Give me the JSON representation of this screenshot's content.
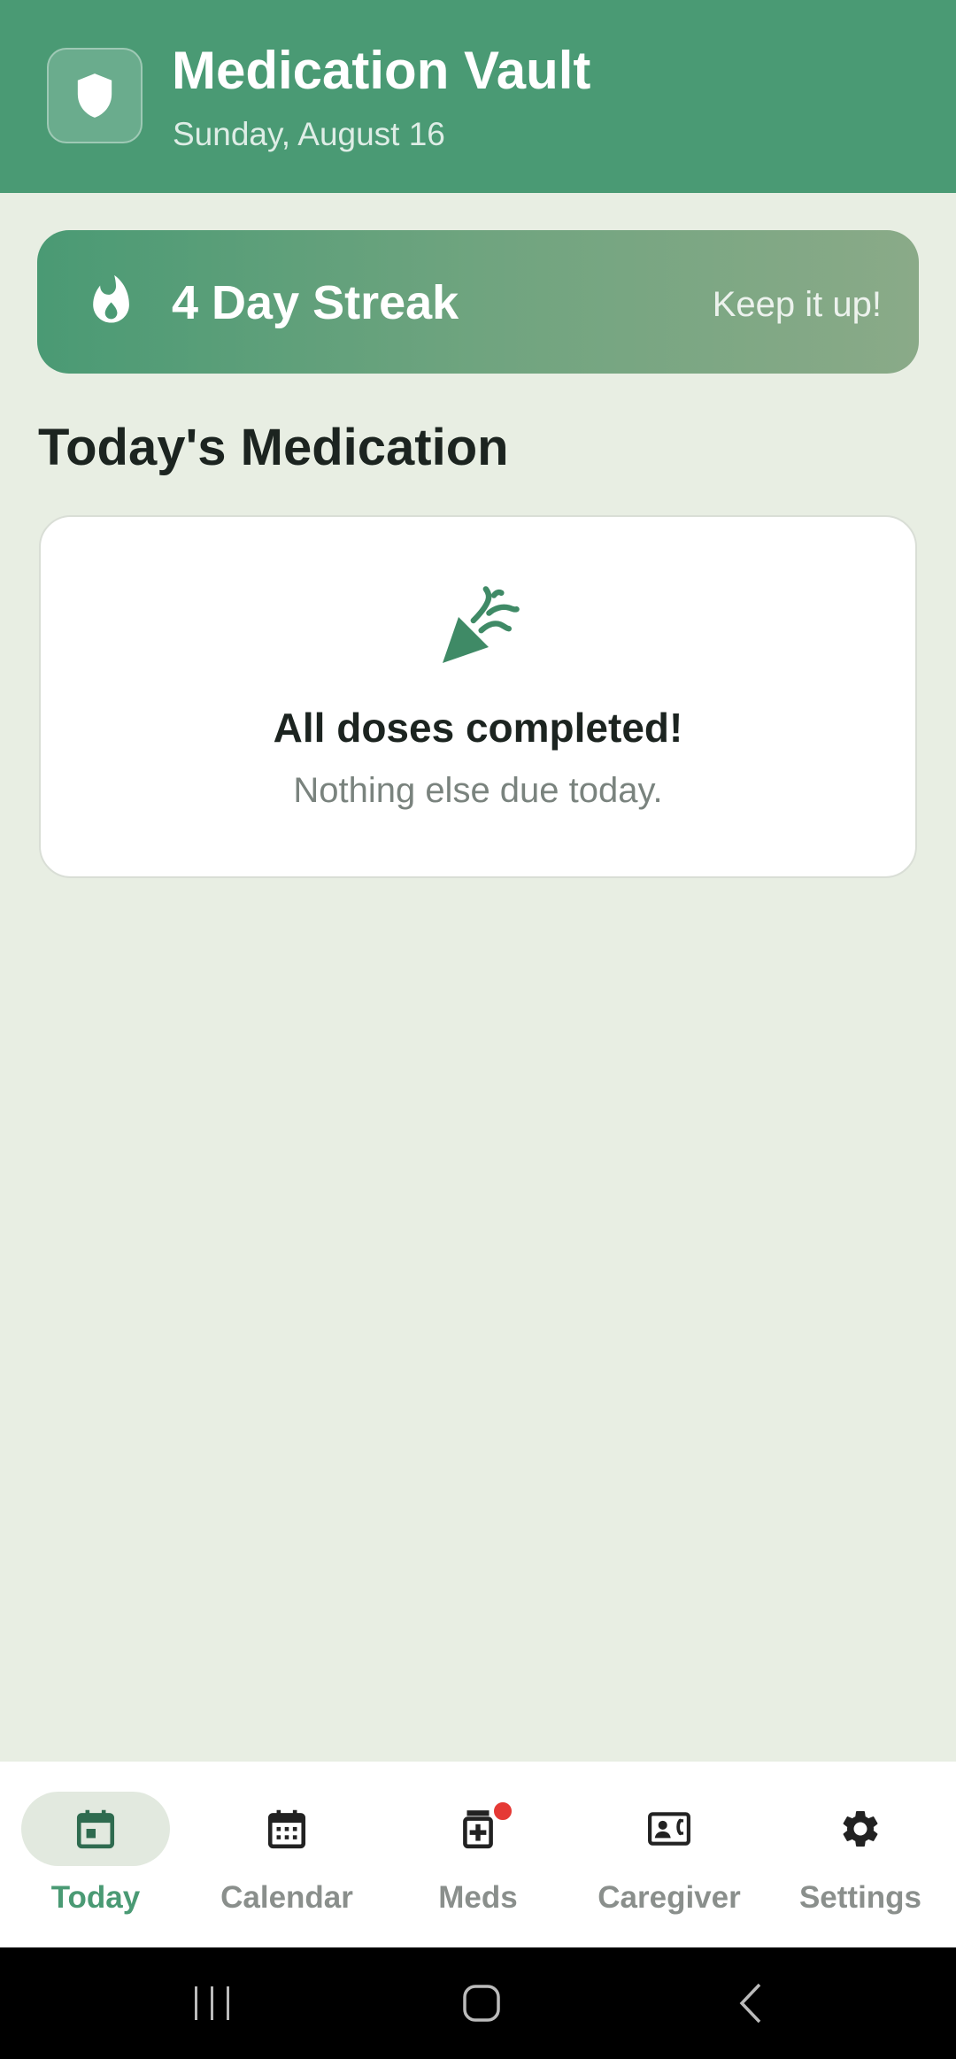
{
  "header": {
    "title": "Medication Vault",
    "date": "Sunday, August 16",
    "logo_icon": "shield-icon",
    "color": "#4A9A74"
  },
  "streak": {
    "title": "4 Day Streak",
    "subtitle": "Keep it up!",
    "icon": "flame-icon"
  },
  "section": {
    "title": "Today's Medication"
  },
  "empty_state": {
    "icon": "party-popper-icon",
    "title": "All doses completed!",
    "subtitle": "Nothing else due today."
  },
  "nav": {
    "items": [
      {
        "label": "Today",
        "icon": "calendar-today-icon",
        "active": true
      },
      {
        "label": "Calendar",
        "icon": "calendar-month-icon",
        "active": false
      },
      {
        "label": "Meds",
        "icon": "medication-icon",
        "active": false,
        "badge": true
      },
      {
        "label": "Caregiver",
        "icon": "contact-phone-icon",
        "active": false
      },
      {
        "label": "Settings",
        "icon": "gear-icon",
        "active": false
      }
    ]
  },
  "system_nav": {
    "items": [
      "recents-button",
      "home-button",
      "back-button"
    ]
  }
}
